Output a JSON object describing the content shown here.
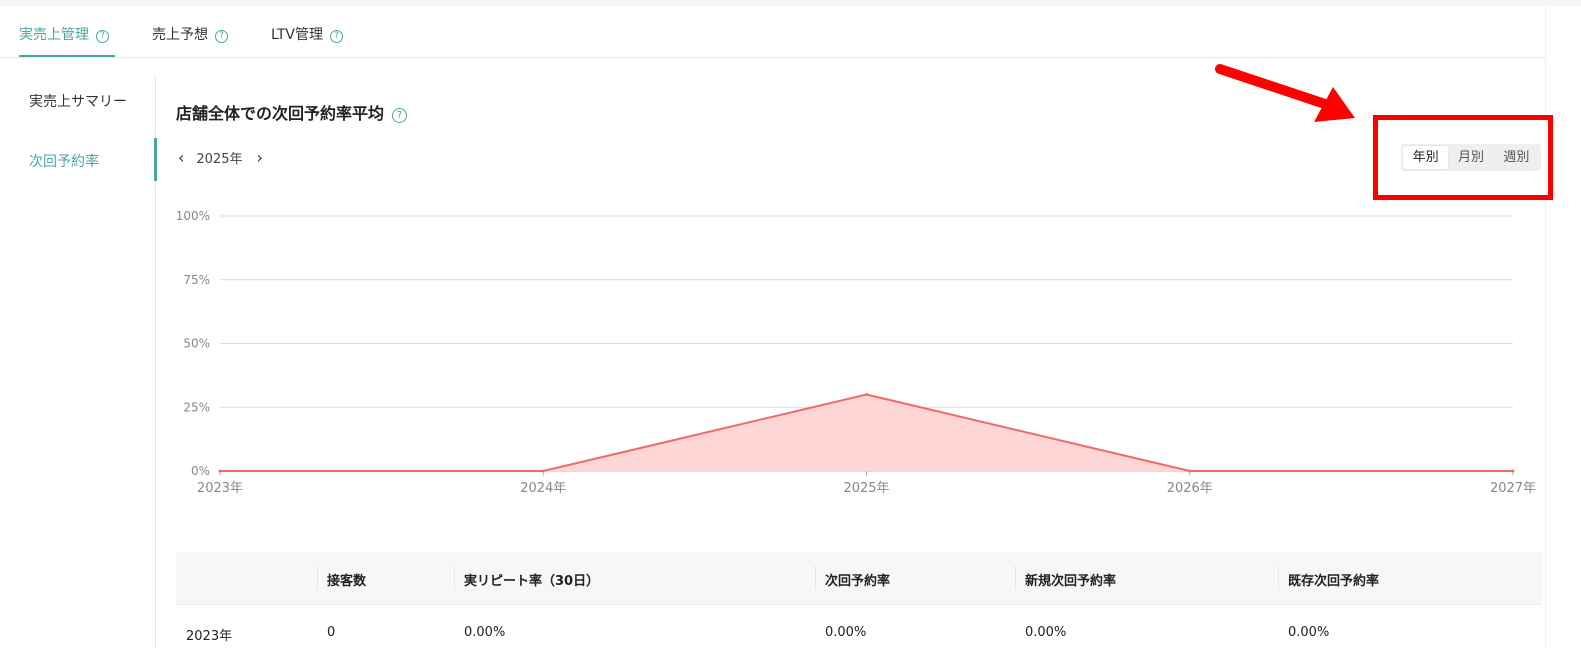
{
  "tabs": [
    {
      "label": "実売上管理"
    },
    {
      "label": "売上予想"
    },
    {
      "label": "LTV管理"
    }
  ],
  "sidebar": {
    "items": [
      {
        "label": "実売上サマリー"
      },
      {
        "label": "次回予約率"
      }
    ]
  },
  "section": {
    "title": "店舗全体での次回予約率平均",
    "period": "2025年"
  },
  "view_toggle": {
    "options": [
      "年別",
      "月別",
      "週別"
    ],
    "selected": "年別"
  },
  "colors": {
    "accent": "#49a6a0",
    "series_line": "#f06a6a",
    "series_fill": "#ffd6d6",
    "annotation": "#ff0000"
  },
  "chart_data": {
    "type": "area",
    "x": [
      "2023年",
      "2024年",
      "2025年",
      "2026年",
      "2027年"
    ],
    "y_ticks": [
      "0%",
      "25%",
      "50%",
      "75%",
      "100%"
    ],
    "ylim": [
      0,
      100
    ],
    "series": [
      {
        "values": [
          0,
          0,
          30,
          0,
          0
        ]
      }
    ],
    "grid": true
  },
  "table": {
    "columns": [
      "",
      "接客数",
      "実リピート率（30日）",
      "次回予約率",
      "新規次回予約率",
      "既存次回予約率"
    ],
    "rows": [
      [
        "2023年",
        "0",
        "0.00%",
        "0.00%",
        "0.00%",
        "0.00%"
      ]
    ]
  }
}
